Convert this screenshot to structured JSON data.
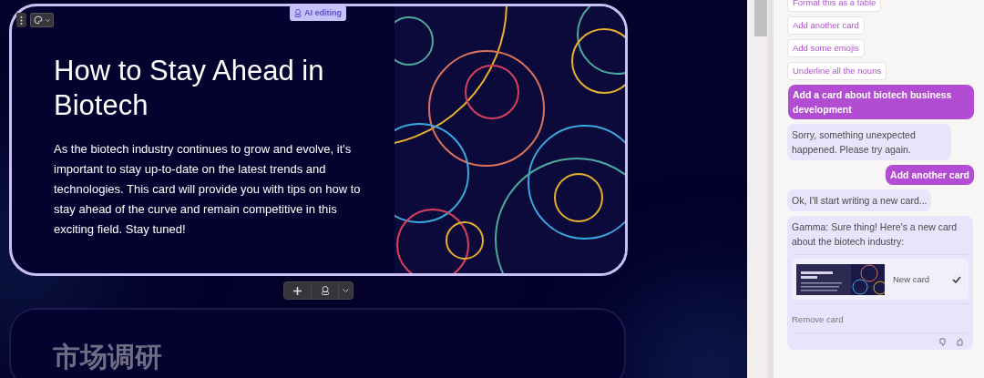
{
  "card": {
    "badge": "AI editing",
    "title": "How to Stay Ahead in Biotech",
    "body": "As the biotech industry continues to grow and evolve, it's important to stay up-to-date on the latest trends and technologies. This card will provide you with tips on how to stay ahead of the curve and remain competitive in this exciting field. Stay tuned!"
  },
  "next_card": {
    "title": "市场调研"
  },
  "chat": {
    "suggestions": [
      "Format this as a table",
      "Add another card",
      "Add some emojis",
      "Underline all the nouns"
    ],
    "messages": [
      {
        "kind": "user",
        "text": "Add a card about biotech business development"
      },
      {
        "kind": "assistant",
        "text": "Sorry, something unexpected happened. Please try again."
      },
      {
        "kind": "user",
        "text": "Add another card"
      },
      {
        "kind": "assistant",
        "text": "Ok, I'll start writing a new card..."
      },
      {
        "kind": "assistant",
        "text": "Gamma: Sure thing! Here's a new card about the biotech industry:",
        "attachment": {
          "label": "New card",
          "checked": true,
          "action": "Remove card"
        }
      }
    ]
  }
}
